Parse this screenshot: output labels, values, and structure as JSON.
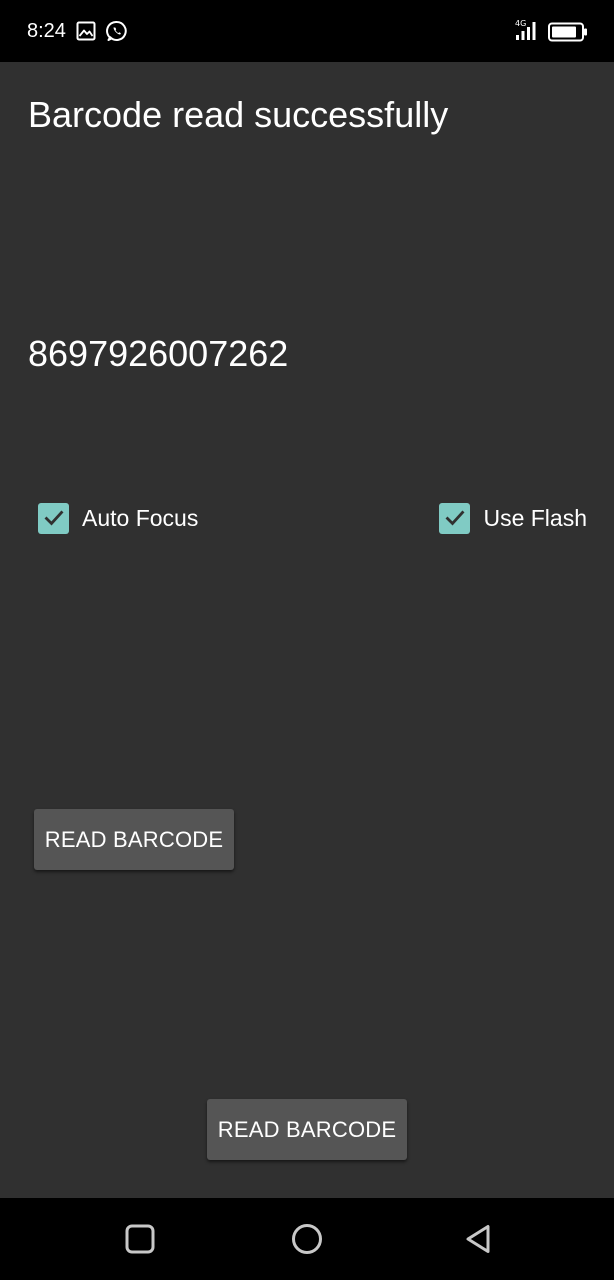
{
  "status_bar": {
    "time": "8:24",
    "network_label": "4G",
    "icons": [
      "gallery-icon",
      "whatsapp-icon",
      "signal-icon",
      "battery-icon"
    ]
  },
  "main": {
    "title": "Barcode read successfully",
    "barcode_value": "8697926007262",
    "checkboxes": [
      {
        "label": "Auto Focus",
        "checked": true
      },
      {
        "label": "Use Flash",
        "checked": true
      }
    ],
    "buttons": [
      {
        "label": "READ BARCODE"
      },
      {
        "label": "READ BARCODE"
      }
    ]
  },
  "nav_bar": {
    "icons": [
      "recents-icon",
      "home-icon",
      "back-icon"
    ]
  },
  "colors": {
    "background": "#303030",
    "bars": "#000000",
    "checkbox_accent": "#80cbc4",
    "button": "#555555",
    "text": "#ffffff"
  }
}
